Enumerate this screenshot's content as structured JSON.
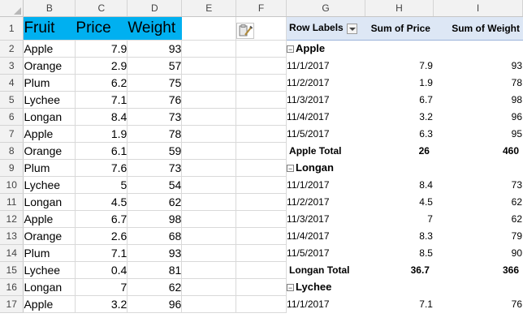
{
  "columns": [
    "B",
    "C",
    "D",
    "E",
    "F",
    "G",
    "H",
    "I"
  ],
  "row_numbers": [
    "1",
    "2",
    "3",
    "4",
    "5",
    "6",
    "7",
    "8",
    "9",
    "10",
    "11",
    "12",
    "13",
    "14",
    "15",
    "16",
    "17"
  ],
  "source": {
    "headers": [
      "Fruit",
      "Price",
      "Weight"
    ],
    "rows": [
      [
        "Apple",
        "7.9",
        "93"
      ],
      [
        "Orange",
        "2.9",
        "57"
      ],
      [
        "Plum",
        "6.2",
        "75"
      ],
      [
        "Lychee",
        "7.1",
        "76"
      ],
      [
        "Longan",
        "8.4",
        "73"
      ],
      [
        "Apple",
        "1.9",
        "78"
      ],
      [
        "Orange",
        "6.1",
        "59"
      ],
      [
        "Plum",
        "7.6",
        "73"
      ],
      [
        "Lychee",
        "5",
        "54"
      ],
      [
        "Longan",
        "4.5",
        "62"
      ],
      [
        "Apple",
        "6.7",
        "98"
      ],
      [
        "Orange",
        "2.6",
        "68"
      ],
      [
        "Plum",
        "7.1",
        "93"
      ],
      [
        "Lychee",
        "0.4",
        "81"
      ],
      [
        "Longan",
        "7",
        "62"
      ],
      [
        "Apple",
        "3.2",
        "96"
      ]
    ]
  },
  "pivot": {
    "headers": [
      "Row Labels",
      "Sum of Price",
      "Sum of Weight"
    ],
    "groups": [
      {
        "name": "Apple",
        "rows": [
          [
            "11/1/2017",
            "7.9",
            "93"
          ],
          [
            "11/2/2017",
            "1.9",
            "78"
          ],
          [
            "11/3/2017",
            "6.7",
            "98"
          ],
          [
            "11/4/2017",
            "3.2",
            "96"
          ],
          [
            "11/5/2017",
            "6.3",
            "95"
          ]
        ],
        "total": [
          "Apple Total",
          "26",
          "460"
        ]
      },
      {
        "name": "Longan",
        "rows": [
          [
            "11/1/2017",
            "8.4",
            "73"
          ],
          [
            "11/2/2017",
            "4.5",
            "62"
          ],
          [
            "11/3/2017",
            "7",
            "62"
          ],
          [
            "11/4/2017",
            "8.3",
            "79"
          ],
          [
            "11/5/2017",
            "8.5",
            "90"
          ]
        ],
        "total": [
          "Longan Total",
          "36.7",
          "366"
        ]
      },
      {
        "name": "Lychee",
        "rows": [
          [
            "11/1/2017",
            "7.1",
            "76"
          ]
        ]
      }
    ]
  },
  "colors": {
    "header_fill": "#00b0f0",
    "pivot_header_fill": "#dde7f5",
    "grid_line": "#d9d9d9"
  }
}
